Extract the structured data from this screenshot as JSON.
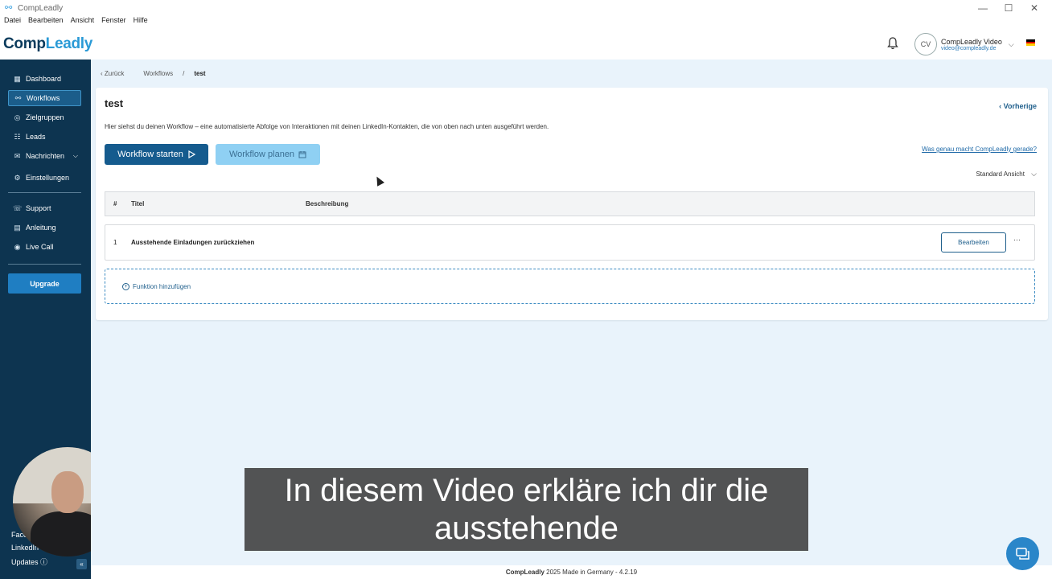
{
  "window": {
    "title": "CompLeadly",
    "controls": [
      "—",
      "☐",
      "✕"
    ]
  },
  "menubar": [
    "Datei",
    "Bearbeiten",
    "Ansicht",
    "Fenster",
    "Hilfe"
  ],
  "header": {
    "logo_main": "Comp",
    "logo_accent": "Leadly",
    "user_initials": "CV",
    "user_name": "CompLeadly Video",
    "user_email": "video@compleadly.de",
    "flag_colors": [
      "#000000",
      "#dd0000",
      "#ffce00"
    ]
  },
  "sidebar": {
    "items": [
      {
        "label": "Dashboard",
        "icon": "dashboard-icon",
        "glyph": "▦"
      },
      {
        "label": "Workflows",
        "icon": "workflow-icon",
        "glyph": "⚯",
        "active": true
      },
      {
        "label": "Zielgruppen",
        "icon": "target-icon",
        "glyph": "◎"
      },
      {
        "label": "Leads",
        "icon": "users-icon",
        "glyph": "☷"
      },
      {
        "label": "Nachrichten",
        "icon": "messages-icon",
        "glyph": "✉"
      },
      {
        "label": "Einstellungen",
        "icon": "gear-icon",
        "glyph": "⚙"
      },
      {
        "label": "Support",
        "icon": "support-icon",
        "glyph": "☏"
      },
      {
        "label": "Anleitung",
        "icon": "book-icon",
        "glyph": "▤"
      },
      {
        "label": "Live Call",
        "icon": "webcam-icon",
        "glyph": "◉"
      }
    ],
    "upgrade_label": "Upgrade",
    "bottom_links": [
      "Face",
      "LinkedIn",
      "Updates"
    ]
  },
  "breadcrumb": {
    "back": "Zurück",
    "parent": "Workflows",
    "current": "test"
  },
  "workflow": {
    "title": "test",
    "prev_label": "Vorherige",
    "description": "Hier siehst du deinen Workflow – eine automatisierte Abfolge von Interaktionen mit deinen LinkedIn-Kontakten, die von oben nach unten ausgeführt werden.",
    "start_label": "Workflow starten",
    "plan_label": "Workflow planen",
    "help_link": "Was genau macht CompLeadly gerade?",
    "view_label": "Standard Ansicht",
    "columns": [
      "#",
      "Titel",
      "Beschreibung"
    ],
    "rows": [
      {
        "num": "1",
        "title": "Ausstehende Einladungen zurückziehen",
        "description": "",
        "edit_label": "Bearbeiten",
        "more": "···"
      }
    ],
    "add_function_label": "Funktion hinzufügen"
  },
  "subtitle": {
    "line1": "In diesem Video erkläre ich dir die",
    "line2": "ausstehende"
  },
  "footer": {
    "brand": "CompLeadly",
    "text": "2025 Made in Germany - 4.2.19"
  },
  "colors": {
    "sidebar_bg": "#0d3450",
    "accent": "#155b8e",
    "content_bg": "#e9f3fb"
  }
}
